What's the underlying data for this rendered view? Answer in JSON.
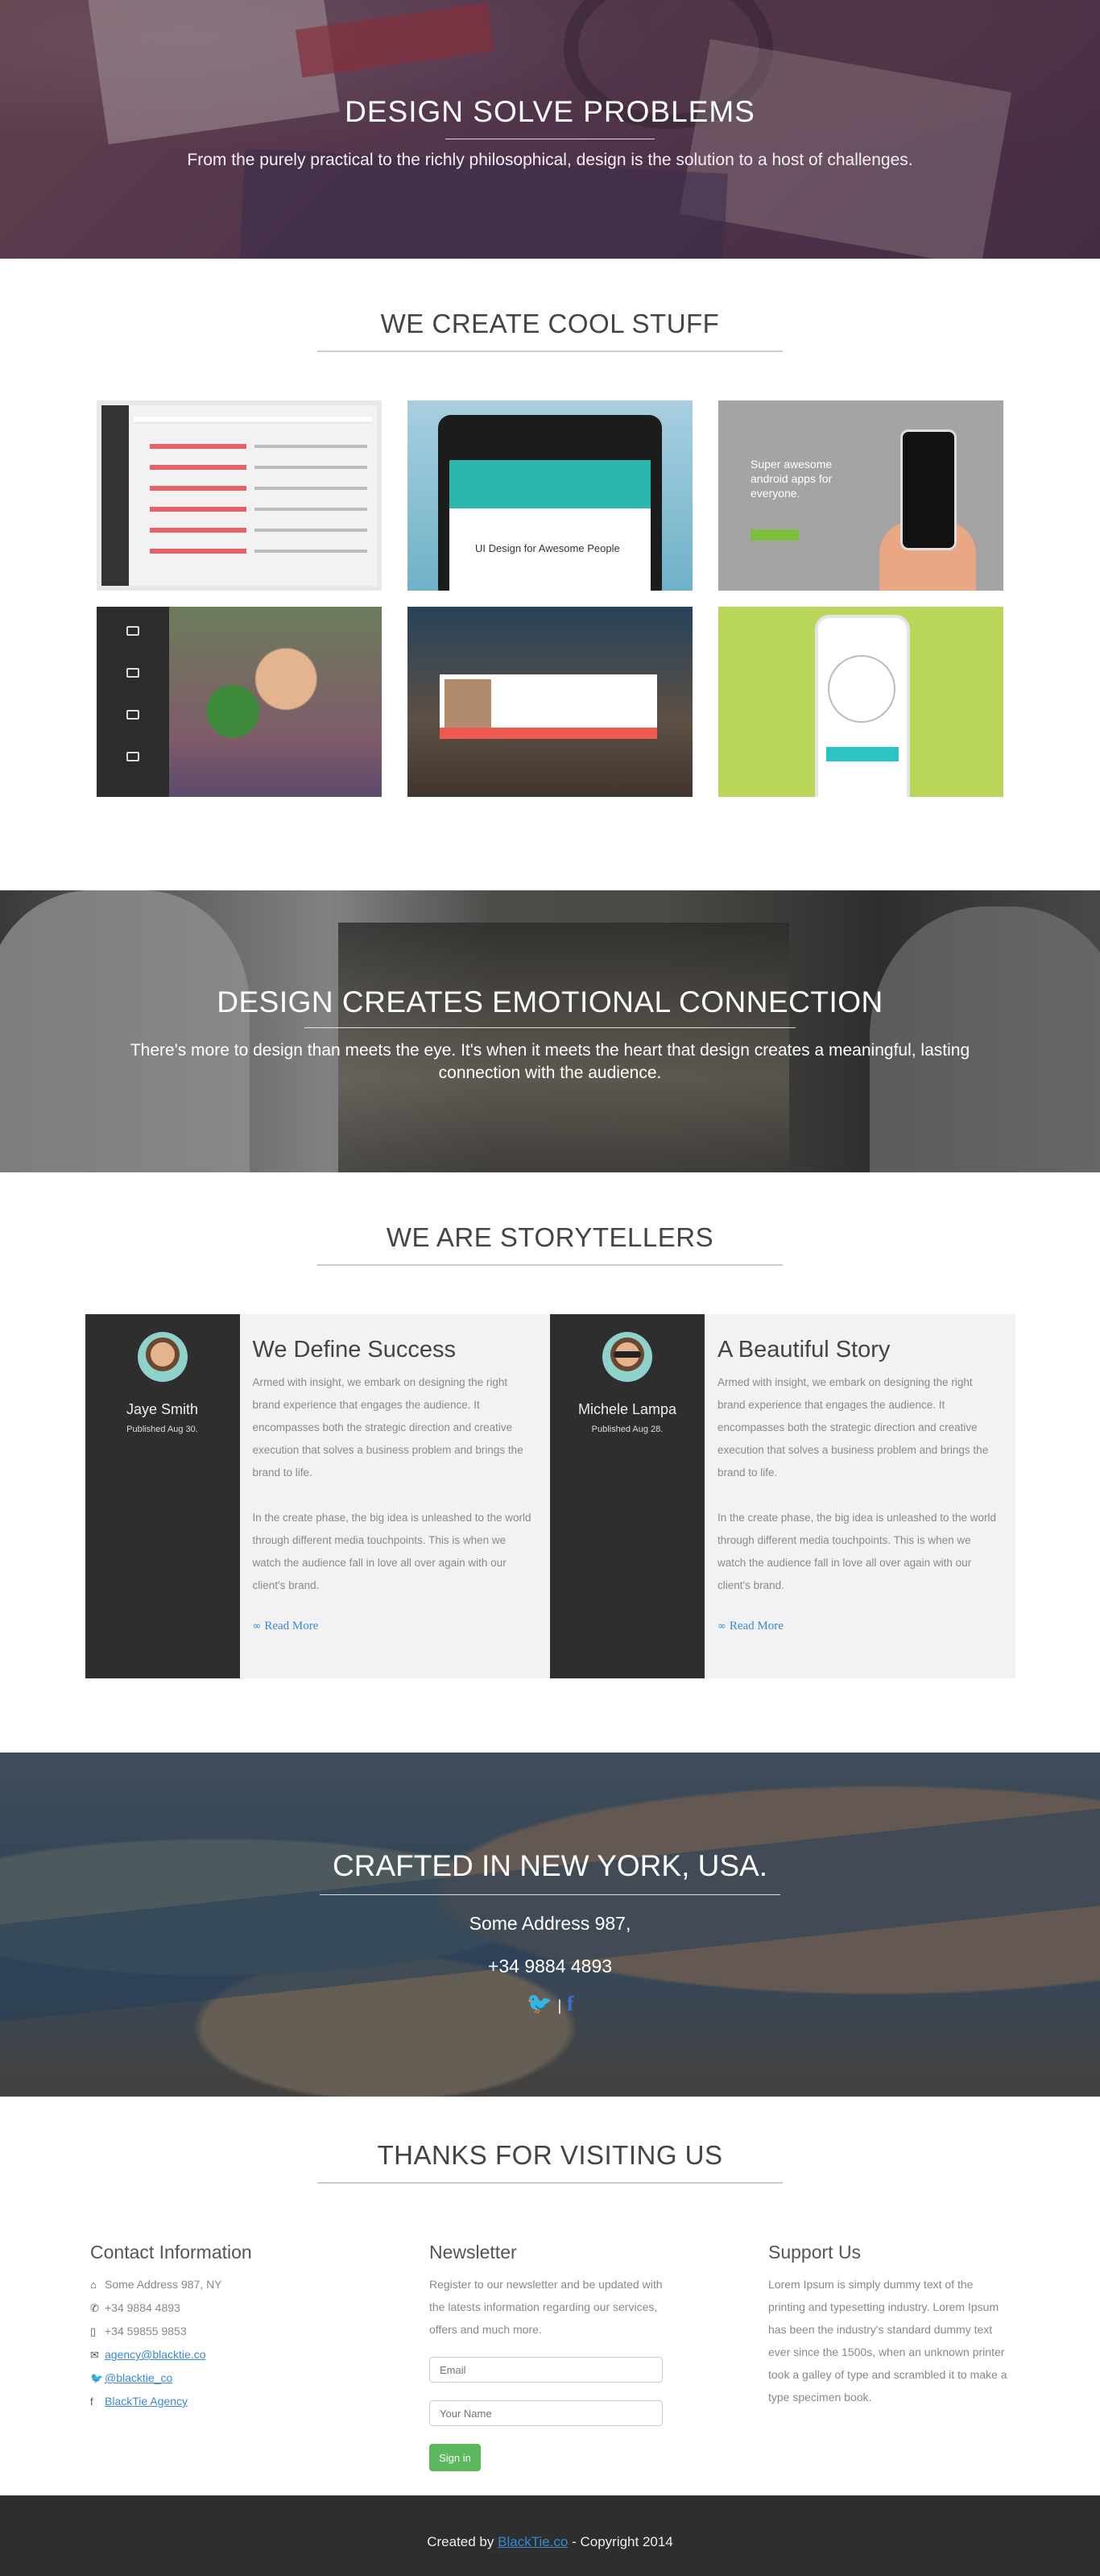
{
  "hero": {
    "title": "DESIGN SOLVE PROBLEMS",
    "subtitle": "From the purely practical to the richly philosophical, design is the solution to a host of challenges."
  },
  "portfolio": {
    "title": "WE CREATE COOL STUFF",
    "tiles": [
      {
        "name": "inbox-dashboard-mockup"
      },
      {
        "name": "tablet-profile-mockup",
        "caption": "UI Design for Awesome People"
      },
      {
        "name": "android-app-mockup",
        "text": "Super awesome android apps for everyone."
      },
      {
        "name": "profile-app-mockup"
      },
      {
        "name": "notification-card-mockup"
      },
      {
        "name": "radar-phone-mockup"
      }
    ]
  },
  "connection": {
    "title": "DESIGN CREATES EMOTIONAL CONNECTION",
    "text": "There's more to design than meets the eye. It's when it meets the heart that design creates a meaningful, lasting connection with the audience."
  },
  "stories": {
    "title": "WE ARE STORYTELLERS",
    "cards": [
      {
        "author": "Jaye Smith",
        "published": "Published Aug 30.",
        "heading": "We Define Success",
        "p1": "Armed with insight, we embark on designing the right brand experience that engages the audience. It encompasses both the strategic direction and creative execution that solves a business problem and brings the brand to life.",
        "p2": "In the create phase, the big idea is unleashed to the world through different media touchpoints. This is when we watch the audience fall in love all over again with our client's brand.",
        "read_more": "Read More"
      },
      {
        "author": "Michele Lampa",
        "published": "Published Aug 28.",
        "heading": "A Beautiful Story",
        "p1": "Armed with insight, we embark on designing the right brand experience that engages the audience. It encompasses both the strategic direction and creative execution that solves a business problem and brings the brand to life.",
        "p2": "In the create phase, the big idea is unleashed to the world through different media touchpoints. This is when we watch the audience fall in love all over again with our client's brand.",
        "read_more": "Read More"
      }
    ]
  },
  "city": {
    "title": "CRAFTED IN NEW YORK, USA.",
    "address": "Some Address 987,",
    "phone": "+34 9884 4893",
    "social_separator": "|"
  },
  "thanks": {
    "title": "THANKS FOR VISITING US",
    "contact": {
      "heading": "Contact Information",
      "address": "Some Address 987, NY",
      "phone": "+34 9884 4893",
      "mobile": "+34 59855 9853",
      "email": "agency@blacktie.co",
      "twitter": "@blacktie_co",
      "facebook": "BlackTie Agency"
    },
    "newsletter": {
      "heading": "Newsletter",
      "text": "Register to our newsletter and be updated with the latests information regarding our services, offers and much more.",
      "email_placeholder": "Email",
      "name_placeholder": "Your Name",
      "button": "Sign in"
    },
    "support": {
      "heading": "Support Us",
      "text": "Lorem Ipsum is simply dummy text of the printing and typesetting industry. Lorem Ipsum has been the industry's standard dummy text ever since the 1500s, when an unknown printer took a galley of type and scrambled it to make a type specimen book."
    }
  },
  "footer": {
    "prefix": "Created by ",
    "brand": "BlackTie.co",
    "suffix": " - Copyright 2014"
  },
  "colors": {
    "accent": "#3a88d6",
    "dark": "#2e2e2e",
    "green_button": "#5cb85c"
  }
}
